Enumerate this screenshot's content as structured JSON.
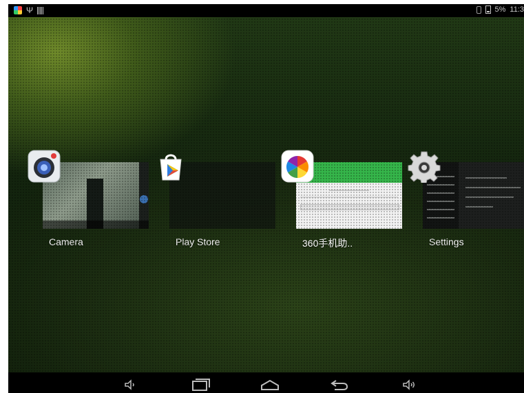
{
  "status_bar": {
    "left_icons": [
      "app-360-icon",
      "usb-icon",
      "barcode-icon"
    ],
    "right_icons": [
      "vibrate-icon",
      "battery-icon"
    ],
    "battery_text": "5%",
    "time_text": "11:3"
  },
  "recent_apps": [
    {
      "label": "Camera",
      "icon": "camera-icon"
    },
    {
      "label": "Play Store",
      "icon": "play-store-icon"
    },
    {
      "label": "360手机助..",
      "icon": "360-assistant-icon"
    },
    {
      "label": "Settings",
      "icon": "gear-icon"
    }
  ],
  "nav_bar": {
    "buttons": [
      "volume-down-icon",
      "recent-apps-icon",
      "home-icon",
      "back-icon",
      "volume-up-icon"
    ]
  },
  "colors": {
    "status_bar_bg": "#000000",
    "nav_bar_bg": "#000000",
    "wallpaper": "#1b2c11",
    "label_text": "#ffffff",
    "assistant_green": "#35b54a"
  }
}
